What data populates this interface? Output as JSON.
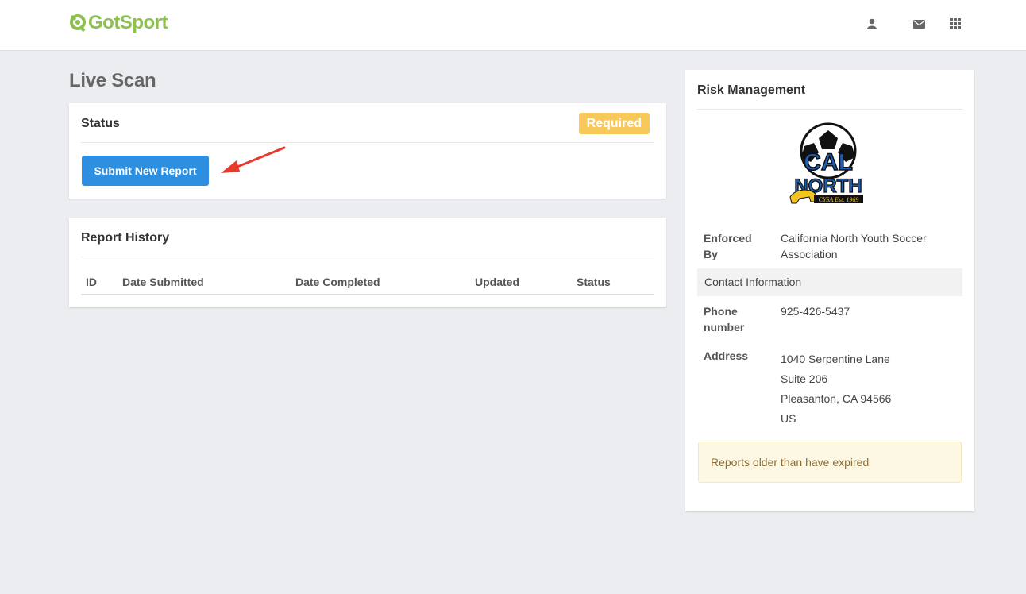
{
  "brand": {
    "logo_text": "GotSport",
    "logo_color": "#8cc04f"
  },
  "nav": {
    "icons": [
      "user-icon",
      "envelope-icon",
      "apps-grid-icon"
    ]
  },
  "page": {
    "title": "Live Scan"
  },
  "status_card": {
    "heading": "Status",
    "badge": "Required",
    "badge_color": "#f7c85a",
    "submit_button": "Submit New Report",
    "button_color": "#2e8fe0"
  },
  "history_card": {
    "heading": "Report History",
    "columns": [
      "ID",
      "Date Submitted",
      "Date Completed",
      "Updated",
      "Status"
    ]
  },
  "risk_card": {
    "heading": "Risk Management",
    "crest_text": {
      "line1": "CAL",
      "line2": "NORTH",
      "tagline": "CYSA Est. 1969"
    },
    "enforced_by_label": [
      "Enforced",
      "By"
    ],
    "enforced_by_value": [
      "California North Youth Soccer",
      "Association"
    ],
    "contact_heading": "Contact Information",
    "phone_label": [
      "Phone",
      "number"
    ],
    "phone_value": "925-426-5437",
    "address_label": "Address",
    "address_lines": [
      "1040 Serpentine Lane",
      "Suite 206",
      "Pleasanton, CA 94566",
      "US"
    ],
    "alert_text": "Reports older than have expired"
  }
}
